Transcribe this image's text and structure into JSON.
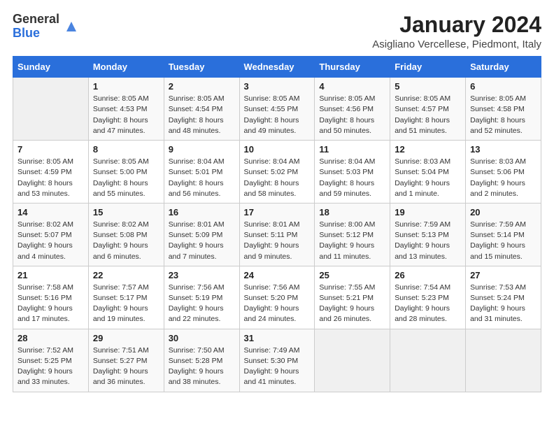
{
  "header": {
    "logo_general": "General",
    "logo_blue": "Blue",
    "title": "January 2024",
    "subtitle": "Asigliano Vercellese, Piedmont, Italy"
  },
  "weekdays": [
    "Sunday",
    "Monday",
    "Tuesday",
    "Wednesday",
    "Thursday",
    "Friday",
    "Saturday"
  ],
  "weeks": [
    [
      {
        "day": "",
        "info": ""
      },
      {
        "day": "1",
        "info": "Sunrise: 8:05 AM\nSunset: 4:53 PM\nDaylight: 8 hours\nand 47 minutes."
      },
      {
        "day": "2",
        "info": "Sunrise: 8:05 AM\nSunset: 4:54 PM\nDaylight: 8 hours\nand 48 minutes."
      },
      {
        "day": "3",
        "info": "Sunrise: 8:05 AM\nSunset: 4:55 PM\nDaylight: 8 hours\nand 49 minutes."
      },
      {
        "day": "4",
        "info": "Sunrise: 8:05 AM\nSunset: 4:56 PM\nDaylight: 8 hours\nand 50 minutes."
      },
      {
        "day": "5",
        "info": "Sunrise: 8:05 AM\nSunset: 4:57 PM\nDaylight: 8 hours\nand 51 minutes."
      },
      {
        "day": "6",
        "info": "Sunrise: 8:05 AM\nSunset: 4:58 PM\nDaylight: 8 hours\nand 52 minutes."
      }
    ],
    [
      {
        "day": "7",
        "info": "Sunrise: 8:05 AM\nSunset: 4:59 PM\nDaylight: 8 hours\nand 53 minutes."
      },
      {
        "day": "8",
        "info": "Sunrise: 8:05 AM\nSunset: 5:00 PM\nDaylight: 8 hours\nand 55 minutes."
      },
      {
        "day": "9",
        "info": "Sunrise: 8:04 AM\nSunset: 5:01 PM\nDaylight: 8 hours\nand 56 minutes."
      },
      {
        "day": "10",
        "info": "Sunrise: 8:04 AM\nSunset: 5:02 PM\nDaylight: 8 hours\nand 58 minutes."
      },
      {
        "day": "11",
        "info": "Sunrise: 8:04 AM\nSunset: 5:03 PM\nDaylight: 8 hours\nand 59 minutes."
      },
      {
        "day": "12",
        "info": "Sunrise: 8:03 AM\nSunset: 5:04 PM\nDaylight: 9 hours\nand 1 minute."
      },
      {
        "day": "13",
        "info": "Sunrise: 8:03 AM\nSunset: 5:06 PM\nDaylight: 9 hours\nand 2 minutes."
      }
    ],
    [
      {
        "day": "14",
        "info": "Sunrise: 8:02 AM\nSunset: 5:07 PM\nDaylight: 9 hours\nand 4 minutes."
      },
      {
        "day": "15",
        "info": "Sunrise: 8:02 AM\nSunset: 5:08 PM\nDaylight: 9 hours\nand 6 minutes."
      },
      {
        "day": "16",
        "info": "Sunrise: 8:01 AM\nSunset: 5:09 PM\nDaylight: 9 hours\nand 7 minutes."
      },
      {
        "day": "17",
        "info": "Sunrise: 8:01 AM\nSunset: 5:11 PM\nDaylight: 9 hours\nand 9 minutes."
      },
      {
        "day": "18",
        "info": "Sunrise: 8:00 AM\nSunset: 5:12 PM\nDaylight: 9 hours\nand 11 minutes."
      },
      {
        "day": "19",
        "info": "Sunrise: 7:59 AM\nSunset: 5:13 PM\nDaylight: 9 hours\nand 13 minutes."
      },
      {
        "day": "20",
        "info": "Sunrise: 7:59 AM\nSunset: 5:14 PM\nDaylight: 9 hours\nand 15 minutes."
      }
    ],
    [
      {
        "day": "21",
        "info": "Sunrise: 7:58 AM\nSunset: 5:16 PM\nDaylight: 9 hours\nand 17 minutes."
      },
      {
        "day": "22",
        "info": "Sunrise: 7:57 AM\nSunset: 5:17 PM\nDaylight: 9 hours\nand 19 minutes."
      },
      {
        "day": "23",
        "info": "Sunrise: 7:56 AM\nSunset: 5:19 PM\nDaylight: 9 hours\nand 22 minutes."
      },
      {
        "day": "24",
        "info": "Sunrise: 7:56 AM\nSunset: 5:20 PM\nDaylight: 9 hours\nand 24 minutes."
      },
      {
        "day": "25",
        "info": "Sunrise: 7:55 AM\nSunset: 5:21 PM\nDaylight: 9 hours\nand 26 minutes."
      },
      {
        "day": "26",
        "info": "Sunrise: 7:54 AM\nSunset: 5:23 PM\nDaylight: 9 hours\nand 28 minutes."
      },
      {
        "day": "27",
        "info": "Sunrise: 7:53 AM\nSunset: 5:24 PM\nDaylight: 9 hours\nand 31 minutes."
      }
    ],
    [
      {
        "day": "28",
        "info": "Sunrise: 7:52 AM\nSunset: 5:25 PM\nDaylight: 9 hours\nand 33 minutes."
      },
      {
        "day": "29",
        "info": "Sunrise: 7:51 AM\nSunset: 5:27 PM\nDaylight: 9 hours\nand 36 minutes."
      },
      {
        "day": "30",
        "info": "Sunrise: 7:50 AM\nSunset: 5:28 PM\nDaylight: 9 hours\nand 38 minutes."
      },
      {
        "day": "31",
        "info": "Sunrise: 7:49 AM\nSunset: 5:30 PM\nDaylight: 9 hours\nand 41 minutes."
      },
      {
        "day": "",
        "info": ""
      },
      {
        "day": "",
        "info": ""
      },
      {
        "day": "",
        "info": ""
      }
    ]
  ]
}
